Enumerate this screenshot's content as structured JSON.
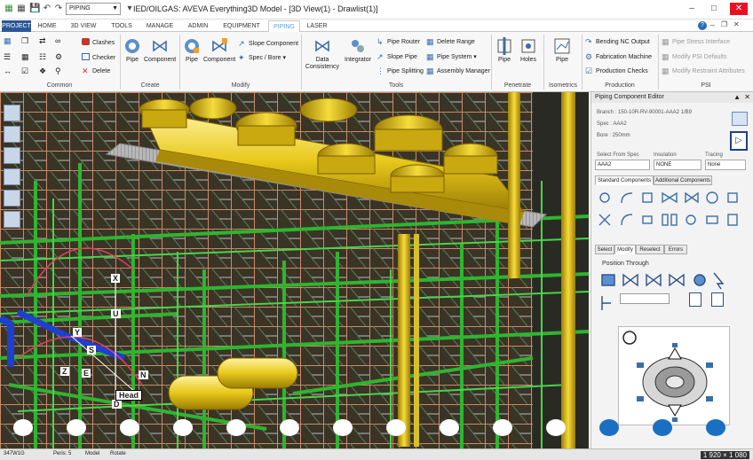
{
  "window": {
    "project": "PIPING",
    "title": "IED/OILGAS: AVEVA Everything3D Model - [3D View(1) - Drawlist(1)]"
  },
  "tabs": [
    "PROJECT",
    "HOME",
    "3D VIEW",
    "TOOLS",
    "MANAGE",
    "ADMIN",
    "EQUIPMENT",
    "PIPING",
    "LASER"
  ],
  "ribbon": {
    "common": {
      "label": "Common",
      "clashes": "Clashes",
      "checker": "Checker",
      "delete": "Delete"
    },
    "create": {
      "label": "Create",
      "pipe": "Pipe",
      "component": "Component"
    },
    "modify": {
      "label": "Modify",
      "pipe": "Pipe",
      "component": "Component",
      "slope_component": "Slope Component",
      "spec_bore": "Spec / Bore"
    },
    "tools": {
      "label": "Tools",
      "data_consistency": "Data Consistency",
      "integrator": "Integrator",
      "pipe_router": "Pipe Router",
      "slope_pipe": "Slope Pipe",
      "pipe_splitting": "Pipe Splitting",
      "delete_range": "Delete Range",
      "pipe_system": "Pipe System",
      "assembly_manager": "Assembly Manager"
    },
    "penetrate": {
      "label": "Penetrate",
      "pipe": "Pipe",
      "holes": "Holes"
    },
    "isometrics": {
      "label": "Isometrics",
      "pipe": "Pipe"
    },
    "production": {
      "label": "Production",
      "bending_nc": "Bending NC Output",
      "fabrication": "Fabrication Machine",
      "production_checks": "Production Checks"
    },
    "psi": {
      "label": "PSI",
      "stress": "Pipe Stress Interface",
      "psi_defaults": "Modify PSI Defaults",
      "restraint": "Modify Restraint Attributes"
    }
  },
  "panel": {
    "title": "Piping Component Editor",
    "branch": "Branch : 150-10R-RV-90001-AAA2 1/B9",
    "spec": "Spec : AAA2",
    "bore": "Bore : 250mm",
    "select_from_spec_label": "Select From Spec",
    "select_from_spec_value": "AAA2",
    "insulation_label": "Insulation",
    "insulation_value": "NONE",
    "tracing_label": "Tracing",
    "tracing_value": "None",
    "comp_tabs": [
      "Standard Components",
      "Additional Components"
    ],
    "mode_tabs": [
      "Select",
      "Modify",
      "Reselect",
      "Errors"
    ],
    "position_through": "Position Through"
  },
  "view_labels": {
    "x": "X",
    "u": "U",
    "y": "Y",
    "s": "S",
    "z": "Z",
    "e": "E",
    "n": "N",
    "d": "D",
    "head": "Head"
  },
  "status": {
    "left": "347W1G",
    "mid": "Peris: 5",
    "model": "Model",
    "rotate": "Rotate"
  },
  "resolution": "1 920 × 1 080"
}
